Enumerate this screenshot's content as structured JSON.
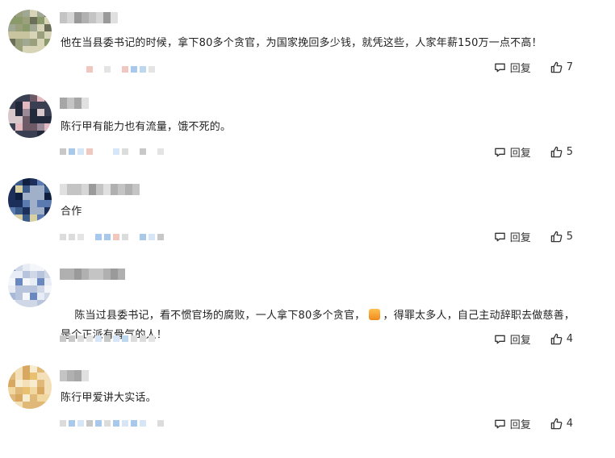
{
  "reply_label": "回复",
  "comments": [
    {
      "id": "c1",
      "text": "他在当县委书记的时候，拿下80多个贪官，为国家挽回多少钱，就凭这些，人家年薪150万一点不高！",
      "likes": "7",
      "avatar_colors": [
        "#8a9a6a",
        "#c9c4a0",
        "#6b6f5a",
        "#a0a894",
        "#d8d4b8",
        "#9aa07c"
      ]
    },
    {
      "id": "c2",
      "text": "陈行甲有能力也有流量，饿不死的。",
      "likes": "5",
      "avatar_colors": [
        "#3a3f52",
        "#d8c8cc",
        "#6d5a66",
        "#e4b8c0",
        "#22293a",
        "#9a8a98"
      ]
    },
    {
      "id": "c3",
      "text": "合作",
      "likes": "5",
      "avatar_colors": [
        "#1c2f5a",
        "#3a5a8a",
        "#d8d0a0",
        "#0f1f40",
        "#5a7ab0",
        "#a0b0c8"
      ]
    },
    {
      "id": "c4",
      "text_before": "陈当过县委书记，看不惯官场的腐败，一人拿下80多个贪官，",
      "emoji": "thumbs-up-emoji",
      "text_after": "，得罪太多人，自己主动辞职去做慈善，是个正派有骨气的人！",
      "likes": "4",
      "avatar_colors": [
        "#e8ecf4",
        "#a8b8d8",
        "#6a88c0",
        "#d0d8e8",
        "#f4f6fa",
        "#b8c4dc"
      ]
    },
    {
      "id": "c5",
      "text": "陈行甲爱讲大实话。",
      "likes": "4",
      "avatar_colors": [
        "#f0d8a0",
        "#e8c070",
        "#f8ecd0",
        "#d8a860",
        "#f4e0b8",
        "#e0b878"
      ]
    }
  ],
  "colors": {
    "text": "#222222",
    "action": "#333333",
    "blur_blue": "#bcd8f0",
    "blur_gray": "#c8c8c8"
  }
}
